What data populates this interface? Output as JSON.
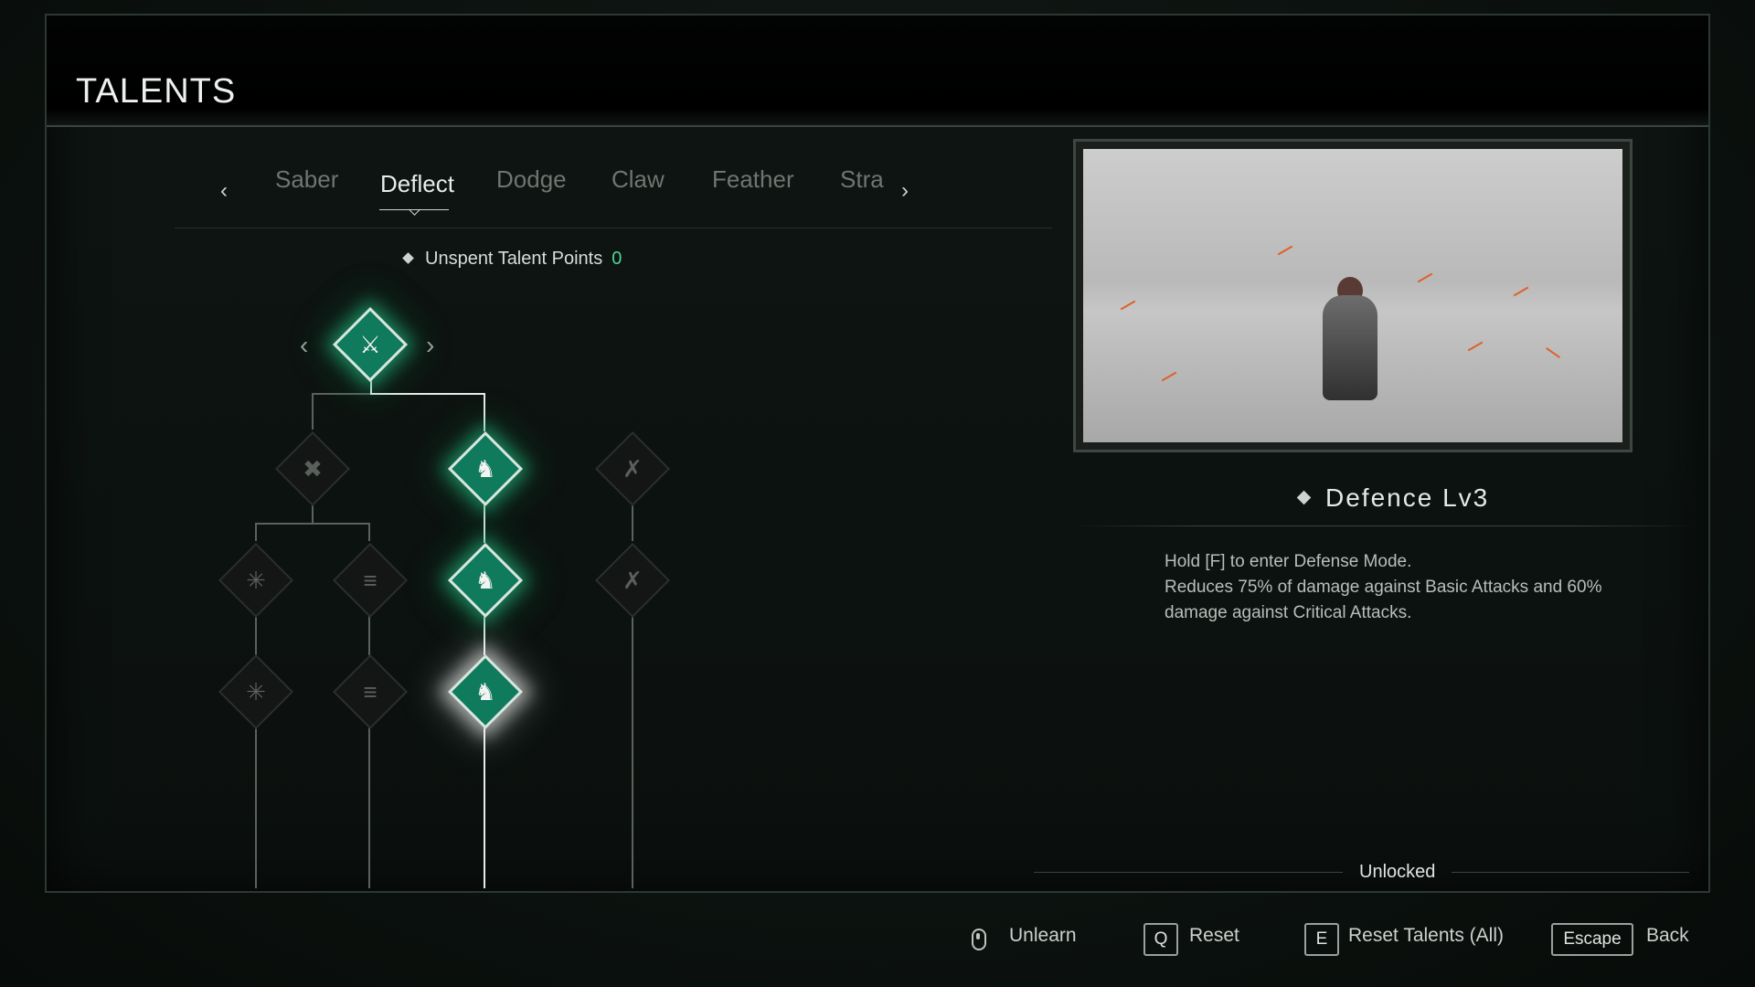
{
  "header": {
    "title": "TALENTS"
  },
  "tabs": [
    {
      "label": "Saber",
      "active": false
    },
    {
      "label": "Deflect",
      "active": true
    },
    {
      "label": "Dodge",
      "active": false
    },
    {
      "label": "Claw",
      "active": false
    },
    {
      "label": "Feather",
      "active": false
    },
    {
      "label": "Stra",
      "active": false
    }
  ],
  "nav": {
    "prev_icon": "arrow-left-icon",
    "next_icon": "arrow-right-icon"
  },
  "points": {
    "label": "Unspent Talent Points",
    "value": "0"
  },
  "skill": {
    "name": "Defence Lv3",
    "description": [
      "Hold [F] to enter Defense Mode.",
      "Reduces 75% of damage against Basic Attacks and 60%",
      "damage against Critical Attacks."
    ],
    "status": "Unlocked"
  },
  "footer": {
    "unlearn_label": "Unlearn",
    "reset_key": "Q",
    "reset_label": "Reset",
    "reset_all_key": "E",
    "reset_all_label": "Reset Talents (All)",
    "back_key": "Escape",
    "back_label": "Back"
  },
  "colors": {
    "accent": "#0f7a5c",
    "glow": "#28c88c",
    "points_value": "#4fd39a"
  }
}
